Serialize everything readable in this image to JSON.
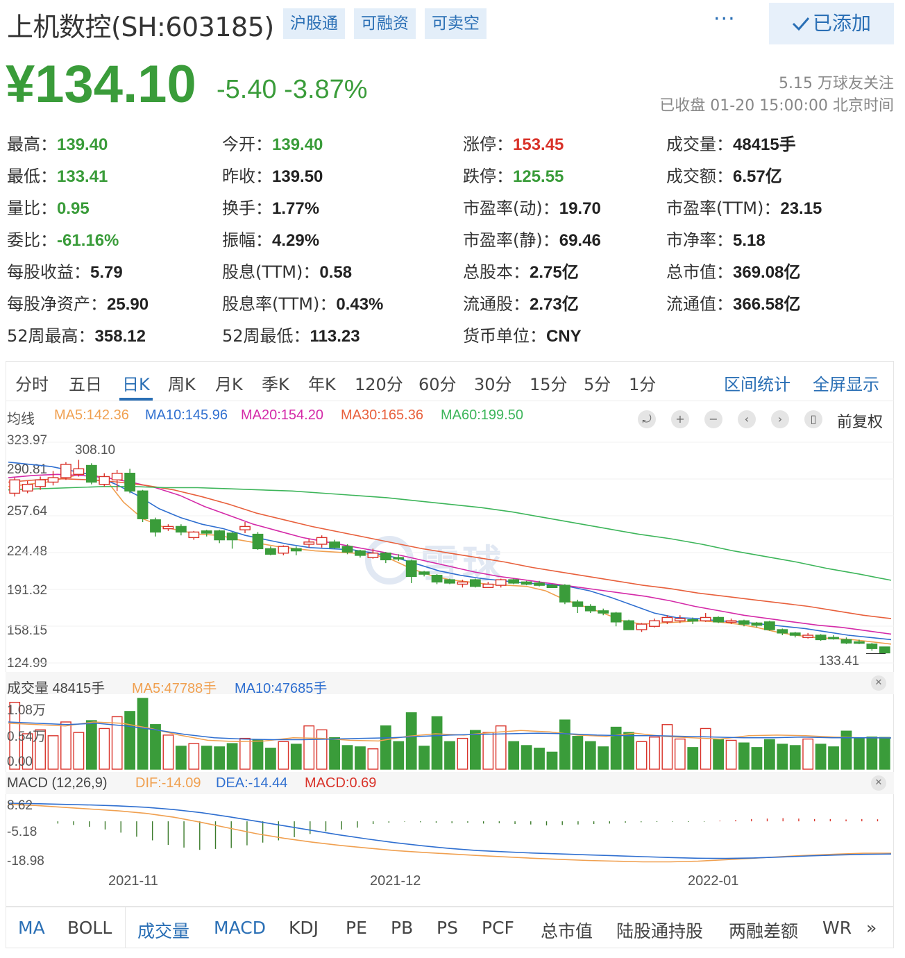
{
  "header": {
    "title": "上机数控(SH:603185)",
    "tags": [
      "沪股通",
      "可融资",
      "可卖空"
    ],
    "more": "···",
    "added_label": "已添加"
  },
  "quote": {
    "price": "¥134.10",
    "change": "-5.40 -3.87%",
    "followers": "5.15 万球友关注",
    "status": "已收盘 01-20 15:00:00 北京时间"
  },
  "stats": [
    {
      "label": "最高：",
      "value": "139.40",
      "color": "#3a9c3a"
    },
    {
      "label": "今开：",
      "value": "139.40",
      "color": "#3a9c3a"
    },
    {
      "label": "涨停：",
      "value": "153.45",
      "color": "#d9332a"
    },
    {
      "label": "成交量：",
      "value": "48415手",
      "color": "#222222"
    },
    {
      "label": "最低：",
      "value": "133.41",
      "color": "#3a9c3a"
    },
    {
      "label": "昨收：",
      "value": "139.50",
      "color": "#222222"
    },
    {
      "label": "跌停：",
      "value": "125.55",
      "color": "#3a9c3a"
    },
    {
      "label": "成交额：",
      "value": "6.57亿",
      "color": "#222222"
    },
    {
      "label": "量比：",
      "value": "0.95",
      "color": "#3a9c3a"
    },
    {
      "label": "换手：",
      "value": "1.77%",
      "color": "#222222"
    },
    {
      "label": "市盈率(动)：",
      "value": "19.70",
      "color": "#222222"
    },
    {
      "label": "市盈率(TTM)：",
      "value": "23.15",
      "color": "#222222"
    },
    {
      "label": "委比：",
      "value": "-61.16%",
      "color": "#3a9c3a"
    },
    {
      "label": "振幅：",
      "value": "4.29%",
      "color": "#222222"
    },
    {
      "label": "市盈率(静)：",
      "value": "69.46",
      "color": "#222222"
    },
    {
      "label": "市净率：",
      "value": "5.18",
      "color": "#222222"
    },
    {
      "label": "每股收益：",
      "value": "5.79",
      "color": "#222222"
    },
    {
      "label": "股息(TTM)：",
      "value": "0.58",
      "color": "#222222"
    },
    {
      "label": "总股本：",
      "value": "2.75亿",
      "color": "#222222"
    },
    {
      "label": "总市值：",
      "value": "369.08亿",
      "color": "#222222"
    },
    {
      "label": "每股净资产：",
      "value": "25.90",
      "color": "#222222"
    },
    {
      "label": "股息率(TTM)：",
      "value": "0.43%",
      "color": "#222222"
    },
    {
      "label": "流通股：",
      "value": "2.73亿",
      "color": "#222222"
    },
    {
      "label": "流通值：",
      "value": "366.58亿",
      "color": "#222222"
    },
    {
      "label": "52周最高：",
      "value": "358.12",
      "color": "#222222"
    },
    {
      "label": "52周最低：",
      "value": "113.23",
      "color": "#222222"
    },
    {
      "label": "货币单位：",
      "value": "CNY",
      "color": "#222222"
    }
  ],
  "period_tabs": [
    "分时",
    "五日",
    "日K",
    "周K",
    "月K",
    "季K",
    "年K",
    "120分",
    "60分",
    "30分",
    "15分",
    "5分",
    "1分"
  ],
  "period_active": "日K",
  "panel_links": [
    "区间统计",
    "全屏显示"
  ],
  "ma_legend": {
    "label": "均线",
    "items": [
      {
        "text": "MA5:142.36",
        "color": "#f0a050"
      },
      {
        "text": "MA10:145.96",
        "color": "#2f6fd0"
      },
      {
        "text": "MA20:154.20",
        "color": "#d42aa8"
      },
      {
        "text": "MA30:165.36",
        "color": "#e8603c"
      },
      {
        "text": "MA60:199.50",
        "color": "#3db55a"
      }
    ]
  },
  "controls": [
    "⤾",
    "+",
    "−",
    "‹",
    "›",
    "▯"
  ],
  "adjust_label": "前复权",
  "price_axis": [
    "323.97",
    "290.81",
    "257.64",
    "224.48",
    "191.32",
    "158.15",
    "124.99"
  ],
  "annotations": {
    "high": "308.10",
    "low": "133.41"
  },
  "watermark": "雪球",
  "volume_legend": {
    "label": "成交量 48415手",
    "items": [
      {
        "text": "MA5:47788手",
        "color": "#f0a050"
      },
      {
        "text": "MA10:47685手",
        "color": "#2f6fd0"
      }
    ],
    "axis": [
      "1.08万",
      "0.54万",
      "0.00"
    ]
  },
  "macd_legend": {
    "label": "MACD (12,26,9)",
    "items": [
      {
        "text": "DIF:-14.09",
        "color": "#f0a050"
      },
      {
        "text": "DEA:-14.44",
        "color": "#2f6fd0"
      },
      {
        "text": "MACD:0.69",
        "color": "#d9332a"
      }
    ],
    "axis": [
      "8.62",
      "-5.18",
      "-18.98"
    ]
  },
  "dates": [
    "2021-11",
    "2021-12",
    "2022-01"
  ],
  "indicator_tabs": [
    "MA",
    "BOLL",
    "成交量",
    "MACD",
    "KDJ",
    "PE",
    "PB",
    "PS",
    "PCF",
    "总市值",
    "陆股通持股",
    "两融差额",
    "WR"
  ],
  "indicator_active": [
    "MA",
    "成交量",
    "MACD"
  ],
  "indicator_more": "»",
  "chart_data": {
    "type": "candlestick",
    "ylim": [
      124.99,
      323.97
    ],
    "candles": [
      {
        "o": 278,
        "c": 290,
        "h": 292,
        "l": 275,
        "v": 10200
      },
      {
        "o": 280,
        "c": 286,
        "h": 289,
        "l": 278,
        "v": 5400
      },
      {
        "o": 284,
        "c": 290,
        "h": 293,
        "l": 281,
        "v": 6000
      },
      {
        "o": 288,
        "c": 292,
        "h": 298,
        "l": 285,
        "v": 5100
      },
      {
        "o": 292,
        "c": 304,
        "h": 306,
        "l": 290,
        "v": 7200
      },
      {
        "o": 295,
        "c": 300,
        "h": 308.1,
        "l": 293,
        "v": 5600
      },
      {
        "o": 303,
        "c": 288,
        "h": 305,
        "l": 286,
        "v": 7400
      },
      {
        "o": 286,
        "c": 293,
        "h": 296,
        "l": 284,
        "v": 6200
      },
      {
        "o": 290,
        "c": 296,
        "h": 299,
        "l": 280,
        "v": 8000
      },
      {
        "o": 296,
        "c": 280,
        "h": 300,
        "l": 278,
        "v": 8800
      },
      {
        "o": 280,
        "c": 255,
        "h": 281,
        "l": 252,
        "v": 10800
      },
      {
        "o": 254,
        "c": 243,
        "h": 256,
        "l": 239,
        "v": 6800
      },
      {
        "o": 246,
        "c": 248,
        "h": 250,
        "l": 244,
        "v": 5200
      },
      {
        "o": 248,
        "c": 243,
        "h": 250,
        "l": 240,
        "v": 3500
      },
      {
        "o": 238,
        "c": 243,
        "h": 244,
        "l": 236,
        "v": 3900
      },
      {
        "o": 244,
        "c": 242,
        "h": 245,
        "l": 239,
        "v": 3500
      },
      {
        "o": 244,
        "c": 236,
        "h": 245,
        "l": 233,
        "v": 3400
      },
      {
        "o": 242,
        "c": 236,
        "h": 243,
        "l": 228,
        "v": 3900
      },
      {
        "o": 245,
        "c": 248,
        "h": 252,
        "l": 242,
        "v": 4700
      },
      {
        "o": 241,
        "c": 228,
        "h": 243,
        "l": 227,
        "v": 4500
      },
      {
        "o": 228,
        "c": 223,
        "h": 230,
        "l": 222,
        "v": 3200
      },
      {
        "o": 224,
        "c": 230,
        "h": 231,
        "l": 222,
        "v": 4200
      },
      {
        "o": 228,
        "c": 226,
        "h": 230,
        "l": 222,
        "v": 3800
      },
      {
        "o": 232,
        "c": 234,
        "h": 237,
        "l": 229,
        "v": 6600
      },
      {
        "o": 232,
        "c": 238,
        "h": 240,
        "l": 229,
        "v": 6000
      },
      {
        "o": 234,
        "c": 229,
        "h": 236,
        "l": 228,
        "v": 4800
      },
      {
        "o": 230,
        "c": 225,
        "h": 232,
        "l": 223,
        "v": 3600
      },
      {
        "o": 226,
        "c": 222,
        "h": 227,
        "l": 220,
        "v": 3400
      },
      {
        "o": 220,
        "c": 224,
        "h": 228,
        "l": 219,
        "v": 3100
      },
      {
        "o": 224,
        "c": 218,
        "h": 225,
        "l": 215,
        "v": 6600
      },
      {
        "o": 220,
        "c": 219,
        "h": 223,
        "l": 217,
        "v": 4200
      },
      {
        "o": 217,
        "c": 203,
        "h": 218,
        "l": 197,
        "v": 8600
      },
      {
        "o": 207,
        "c": 205,
        "h": 208,
        "l": 203,
        "v": 3500
      },
      {
        "o": 204,
        "c": 198,
        "h": 205,
        "l": 196,
        "v": 8000
      },
      {
        "o": 200,
        "c": 197,
        "h": 201,
        "l": 196,
        "v": 4200
      },
      {
        "o": 196,
        "c": 198,
        "h": 200,
        "l": 193,
        "v": 4700
      },
      {
        "o": 200,
        "c": 194,
        "h": 201,
        "l": 193,
        "v": 5900
      },
      {
        "o": 193,
        "c": 196,
        "h": 198,
        "l": 193,
        "v": 5600
      },
      {
        "o": 195,
        "c": 200,
        "h": 201,
        "l": 193,
        "v": 6600
      },
      {
        "o": 200,
        "c": 197,
        "h": 201,
        "l": 196,
        "v": 4200
      },
      {
        "o": 198,
        "c": 196,
        "h": 199,
        "l": 195,
        "v": 3600
      },
      {
        "o": 197,
        "c": 195,
        "h": 199,
        "l": 194,
        "v": 3200
      },
      {
        "o": 195,
        "c": 193,
        "h": 196,
        "l": 193,
        "v": 2600
      },
      {
        "o": 195,
        "c": 180,
        "h": 196,
        "l": 178,
        "v": 7500
      },
      {
        "o": 180,
        "c": 176,
        "h": 182,
        "l": 170,
        "v": 5000
      },
      {
        "o": 176,
        "c": 172,
        "h": 178,
        "l": 170,
        "v": 4200
      },
      {
        "o": 172,
        "c": 170,
        "h": 174,
        "l": 168,
        "v": 3400
      },
      {
        "o": 170,
        "c": 162,
        "h": 171,
        "l": 158,
        "v": 6400
      },
      {
        "o": 163,
        "c": 155,
        "h": 164,
        "l": 155,
        "v": 5600
      },
      {
        "o": 155,
        "c": 160,
        "h": 161,
        "l": 153,
        "v": 4200
      },
      {
        "o": 158,
        "c": 163,
        "h": 165,
        "l": 157,
        "v": 4900
      },
      {
        "o": 162,
        "c": 166,
        "h": 168,
        "l": 160,
        "v": 6800
      },
      {
        "o": 163,
        "c": 165,
        "h": 168,
        "l": 161,
        "v": 4600
      },
      {
        "o": 164,
        "c": 163,
        "h": 166,
        "l": 160,
        "v": 3300
      },
      {
        "o": 163,
        "c": 166,
        "h": 170,
        "l": 162,
        "v": 6200
      },
      {
        "o": 166,
        "c": 162,
        "h": 167,
        "l": 161,
        "v": 4500
      },
      {
        "o": 162,
        "c": 163,
        "h": 165,
        "l": 160,
        "v": 4400
      },
      {
        "o": 163,
        "c": 160,
        "h": 164,
        "l": 158,
        "v": 4000
      },
      {
        "o": 161,
        "c": 159,
        "h": 162,
        "l": 157,
        "v": 3300
      },
      {
        "o": 162,
        "c": 155,
        "h": 163,
        "l": 154,
        "v": 4500
      },
      {
        "o": 155,
        "c": 152,
        "h": 156,
        "l": 150,
        "v": 3800
      },
      {
        "o": 152,
        "c": 150,
        "h": 153,
        "l": 148,
        "v": 3600
      },
      {
        "o": 148,
        "c": 150,
        "h": 152,
        "l": 147,
        "v": 4600
      },
      {
        "o": 150,
        "c": 146,
        "h": 151,
        "l": 145,
        "v": 3800
      },
      {
        "o": 148,
        "c": 147,
        "h": 150,
        "l": 146,
        "v": 3400
      },
      {
        "o": 146,
        "c": 143,
        "h": 148,
        "l": 142,
        "v": 5800
      },
      {
        "o": 144,
        "c": 143,
        "h": 146,
        "l": 142,
        "v": 4700
      },
      {
        "o": 142,
        "c": 138,
        "h": 143,
        "l": 136,
        "v": 4900
      },
      {
        "o": 139.4,
        "c": 134.1,
        "h": 139.4,
        "l": 133.41,
        "v": 4841
      }
    ],
    "ma": [
      {
        "name": "MA5",
        "color": "#f0a050",
        "values": [
          284,
          286,
          288,
          292,
          296,
          292,
          270,
          255,
          248,
          244,
          241,
          240,
          236,
          233,
          230,
          228,
          226,
          225,
          224,
          223,
          218,
          210,
          204,
          200,
          198,
          196,
          195,
          194,
          190,
          182,
          176,
          170,
          163,
          160,
          161,
          162,
          163,
          162,
          160,
          157,
          153,
          150,
          148,
          147,
          146,
          144,
          142
        ]
      },
      {
        "name": "MA10",
        "color": "#2f6fd0",
        "values": [
          306,
          304,
          302,
          298,
          294,
          286,
          276,
          264,
          256,
          250,
          246,
          240,
          236,
          232,
          229,
          228,
          227,
          224,
          220,
          214,
          208,
          204,
          201,
          199,
          197,
          196,
          194,
          190,
          184,
          177,
          170,
          166,
          165,
          163,
          162,
          160,
          158,
          156,
          153,
          150,
          148,
          146
        ]
      },
      {
        "name": "MA20",
        "color": "#d42aa8",
        "values": [
          292,
          294,
          295,
          294,
          292,
          288,
          283,
          276,
          266,
          258,
          250,
          244,
          238,
          234,
          230,
          226,
          222,
          217,
          212,
          207,
          203,
          200,
          197,
          194,
          191,
          188,
          185,
          181,
          176,
          172,
          168,
          165,
          162,
          159,
          157,
          154,
          151
        ]
      },
      {
        "name": "MA30",
        "color": "#e8603c",
        "values": [
          288,
          290,
          291,
          290,
          288,
          285,
          281,
          275,
          268,
          260,
          254,
          248,
          243,
          238,
          233,
          228,
          224,
          220,
          216,
          211,
          207,
          203,
          199,
          195,
          192,
          188,
          185,
          182,
          179,
          176,
          172,
          168,
          165
        ]
      },
      {
        "name": "MA60",
        "color": "#3db55a",
        "values": [
          281,
          282,
          283,
          284,
          284,
          283,
          283,
          282,
          281,
          280,
          278,
          276,
          274,
          271,
          268,
          265,
          261,
          256,
          251,
          246,
          241,
          237,
          232,
          226,
          221,
          216,
          210,
          205,
          199.5
        ]
      }
    ],
    "volume_ma": [
      {
        "name": "MA5",
        "color": "#f0a050",
        "values": [
          7000,
          6800,
          6600,
          7200,
          7000,
          6200,
          5200,
          4400,
          4200,
          4300,
          4800,
          4700,
          4400,
          4300,
          5000,
          5400,
          5200,
          5600,
          5900,
          5700,
          5200,
          5000,
          5500,
          5000,
          4800,
          4600,
          5100,
          5200,
          5100,
          4900,
          4800,
          4778.8
        ]
      },
      {
        "name": "MA10",
        "color": "#2f6fd0",
        "values": [
          7200,
          7000,
          6800,
          7000,
          6600,
          6000,
          5300,
          4800,
          4600,
          4500,
          4500,
          4600,
          4700,
          4800,
          5000,
          5200,
          5300,
          5400,
          5500,
          5400,
          5200,
          5100,
          5100,
          5000,
          4900,
          4800,
          4800,
          4900,
          4800,
          4800,
          4768.5
        ]
      }
    ],
    "volume_ylim": [
      0,
      10800
    ],
    "macd": {
      "ylim": [
        -18.98,
        8.62
      ],
      "dif": [
        7.5,
        7.0,
        6.2,
        5.4,
        4.6,
        3.5,
        1.8,
        -0.5,
        -3,
        -5.5,
        -7.5,
        -9.2,
        -10.6,
        -11.8,
        -12.9,
        -13.7,
        -14.4,
        -15.1,
        -15.7,
        -16.3,
        -16.8,
        -17.3,
        -17.6,
        -17.9,
        -17.9,
        -17.6,
        -17.0,
        -16.3,
        -15.6,
        -15.0,
        -14.5,
        -14.1,
        -14.09
      ],
      "dea": [
        8.0,
        7.8,
        7.5,
        7.2,
        6.8,
        6.2,
        5.2,
        3.8,
        2.0,
        0,
        -2.0,
        -4.0,
        -6.0,
        -7.8,
        -9.4,
        -10.8,
        -12.0,
        -12.9,
        -13.5,
        -14.0,
        -14.4,
        -14.8,
        -15.2,
        -15.6,
        -16.0,
        -16.3,
        -16.4,
        -16.2,
        -15.8,
        -15.3,
        -14.9,
        -14.6,
        -14.44
      ],
      "hist": [
        -1.0,
        -1.6,
        -2.4,
        -3.6,
        -5.0,
        -6.8,
        -8.4,
        -10.4,
        -11.6,
        -12.6,
        -12.2,
        -11.8,
        -10.6,
        -9.4,
        -8.4,
        -7.0,
        -5.6,
        -4.4,
        -3.6,
        -2.8,
        -1.2,
        -0.6,
        -0.2,
        -0.4,
        -0.6,
        -0.8,
        -0.6,
        -1.0,
        -0.8,
        -1.2,
        -1.4,
        -1.8,
        -1.6,
        -1.4,
        -1.2,
        -1.0,
        -0.6,
        -0.4,
        -0.3,
        -0.2,
        -0.3,
        -0.2,
        0.3,
        0.6,
        1.0,
        1.2,
        1.4,
        1.2,
        1.0,
        1.0,
        0.8,
        1.0,
        0.9,
        0.8,
        0.7,
        0.69
      ]
    }
  }
}
